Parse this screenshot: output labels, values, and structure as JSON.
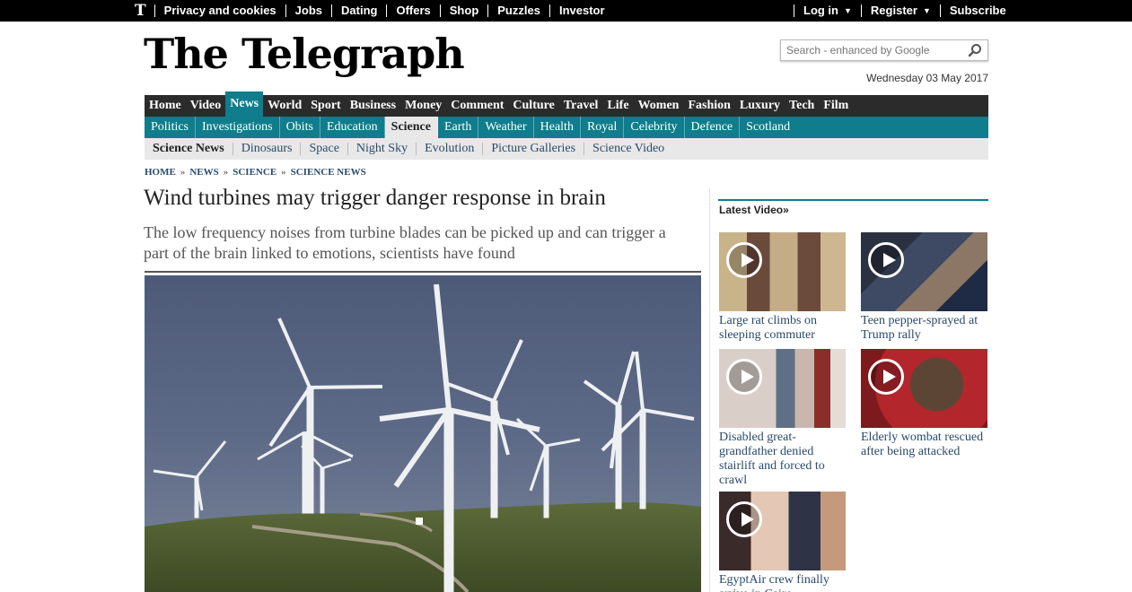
{
  "topbar": {
    "logo": "T",
    "links": [
      "Privacy and cookies",
      "Jobs",
      "Dating",
      "Offers",
      "Shop",
      "Puzzles",
      "Investor"
    ],
    "login": "Log in",
    "register": "Register",
    "subscribe": "Subscribe"
  },
  "masthead": "The Telegraph",
  "search": {
    "placeholder": "Search - enhanced by Google"
  },
  "date": "Wednesday 03 May 2017",
  "main_nav": [
    "Home",
    "Video",
    "News",
    "World",
    "Sport",
    "Business",
    "Money",
    "Comment",
    "Culture",
    "Travel",
    "Life",
    "Women",
    "Fashion",
    "Luxury",
    "Tech",
    "Film"
  ],
  "main_nav_active": "News",
  "sub_nav": [
    "Politics",
    "Investigations",
    "Obits",
    "Education",
    "Science",
    "Earth",
    "Weather",
    "Health",
    "Royal",
    "Celebrity",
    "Defence",
    "Scotland"
  ],
  "sub_nav_active": "Science",
  "subsub_nav": [
    "Science News",
    "Dinosaurs",
    "Space",
    "Night Sky",
    "Evolution",
    "Picture Galleries",
    "Science Video"
  ],
  "breadcrumb": [
    "HOME",
    "NEWS",
    "SCIENCE",
    "SCIENCE NEWS"
  ],
  "breadcrumb_sep": "»",
  "article": {
    "headline": "Wind turbines may trigger danger response in brain",
    "standfirst": "The low frequency noises from turbine blades can be picked up and can trigger a part of the brain linked to emotions, scientists have found"
  },
  "latest_video": {
    "title": "Latest Video»",
    "items": [
      {
        "caption": "Large rat climbs on sleeping commuter"
      },
      {
        "caption": "Teen pepper-sprayed at Trump rally"
      },
      {
        "caption": "Disabled great-grandfather denied stairlift and forced to crawl"
      },
      {
        "caption": "Elderly wombat rescued after being attacked"
      },
      {
        "caption": "EgyptAir crew finally arrive in Cairo"
      }
    ]
  },
  "colors": {
    "teal": "#0f7d8c",
    "nav_dark": "#2b2b2b",
    "link": "#2a4a6a"
  }
}
